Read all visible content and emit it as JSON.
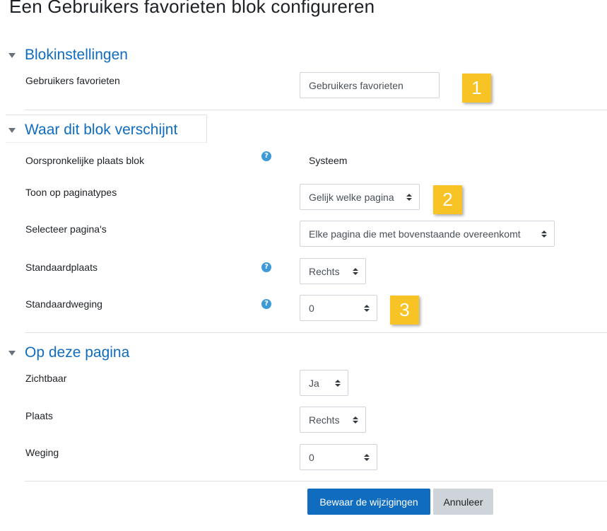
{
  "page": {
    "title": "Een Gebruikers favorieten blok configureren"
  },
  "sections": {
    "block_settings": {
      "title": "Blokinstellingen",
      "fields": {
        "title_label": "Gebruikers favorieten",
        "title_value": "Gebruikers favorieten"
      }
    },
    "where_appears": {
      "title": "Waar dit blok verschijnt",
      "fields": {
        "original_location_label": "Oorspronkelijke plaats blok",
        "original_location_value": "Systeem",
        "page_types_label": "Toon op paginatypes",
        "page_types_value": "Gelijk welke pagina",
        "select_pages_label": "Selecteer pagina's",
        "select_pages_value": "Elke pagina die met bovenstaande overeenkomt",
        "default_region_label": "Standaardplaats",
        "default_region_value": "Rechts",
        "default_weight_label": "Standaardweging",
        "default_weight_value": "0"
      }
    },
    "on_this_page": {
      "title": "Op deze pagina",
      "fields": {
        "visible_label": "Zichtbaar",
        "visible_value": "Ja",
        "region_label": "Plaats",
        "region_value": "Rechts",
        "weight_label": "Weging",
        "weight_value": "0"
      }
    }
  },
  "annotations": [
    "1",
    "2",
    "3"
  ],
  "help_icon_glyph": "?",
  "buttons": {
    "save": "Bewaar de wijzigingen",
    "cancel": "Annuleer"
  },
  "colors": {
    "link_blue": "#0f6cbf",
    "primary": "#0f6cbf",
    "badge": "#f7c325",
    "help_icon": "#3d9ad6"
  }
}
